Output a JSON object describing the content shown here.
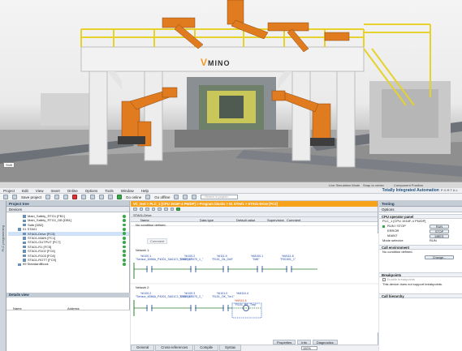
{
  "viewport": {
    "logo_text": "MINO",
    "logo_mark": "V",
    "callout": "Shift",
    "status": [
      "Live Simulation Mode",
      "Snap to vertex",
      "Component Position"
    ]
  },
  "menubar": {
    "items": [
      "Project",
      "Edit",
      "View",
      "Insert",
      "Online",
      "Options",
      "Tools",
      "Window",
      "Help"
    ],
    "brand": "Totally Integrated Automation",
    "brand_sub": "PORTAL"
  },
  "toolbar": {
    "save_label": "Save project",
    "go_online": "Go online",
    "go_offline": "Go offline",
    "search_placeholder": "<Search in project>"
  },
  "project_tree": {
    "title": "Project tree",
    "tab": "Devices",
    "side_label": "PLC programming",
    "items": [
      {
        "label": "Main_Safety_RTG1 [FB1]",
        "indent": 3,
        "ok": true
      },
      {
        "label": "Main_Safety_RTG1_DB [DB1]",
        "indent": 3,
        "ok": true
      },
      {
        "label": "Safe [DB2]",
        "indent": 3,
        "ok": true
      },
      {
        "label": "01 STA01",
        "indent": 2,
        "ok": true
      },
      {
        "label": "STA01-Drive [FC3]",
        "indent": 3,
        "ok": true,
        "selected": true
      },
      {
        "label": "STA01-MAIN [FC1]",
        "indent": 3,
        "ok": true
      },
      {
        "label": "STA01-OUTPUT [FC7]",
        "indent": 3,
        "ok": true
      },
      {
        "label": "STA01-R1 [FC5]",
        "indent": 3,
        "ok": true
      },
      {
        "label": "STA01-R102 [FC6]",
        "indent": 3,
        "ok": true
      },
      {
        "label": "STA01-R103 [FC8]",
        "indent": 3,
        "ok": true
      },
      {
        "label": "STA01-ROTT [FC9]",
        "indent": 3,
        "ok": true
      },
      {
        "label": "99 StandardBlock",
        "indent": 2,
        "ok": true
      }
    ]
  },
  "details_view": {
    "title": "Details view",
    "col_name": "Name",
    "col_address": "Address"
  },
  "editor": {
    "breadcrumb": "VC_test > PLC_1 [CPU 1516F-4 PN/DP] > Program blocks > 01 STA01 > STA01-Drive [FC3]",
    "block_title": "STA01-Drive",
    "columns": [
      "Name",
      "Data type",
      "Default value",
      "Supervision",
      "Comment"
    ],
    "rows": [
      "Input",
      "Output",
      "InOut"
    ],
    "condition": "No condition defined.",
    "comment": "Comment",
    "network1": {
      "label": "Network 1:",
      "contacts": [
        {
          "addr": "%I100.1",
          "tag": "\"Sensor_6066A_P4001_SA01C1_SNS700\""
        },
        {
          "addr": "%I100.2",
          "tag": "\"LS04_LS070_1_\""
        },
        {
          "addr": "%I111.5",
          "tag": "\"R101_Ok_Drill\""
        },
        {
          "addr": "%M100.1",
          "tag": "\"IM8\""
        },
        {
          "addr": "%M111.8",
          "tag": "\"R01501_1\""
        }
      ]
    },
    "network2": {
      "label": "Network 2:",
      "contacts": [
        {
          "addr": "%I100.2",
          "tag": "\"Sensor_6066A_P4001_SA01C1_SNS700\""
        },
        {
          "addr": "%I100.3",
          "tag": "\"LS04_LS070_2_\""
        },
        {
          "addr": "%I101.0",
          "tag": "\"R101_OK_Tm1\""
        }
      ],
      "coil": {
        "addr": "%M110.4",
        "tag": "\"R101_RE_Tmp\"",
        "highlight": "%M111.6"
      }
    },
    "zoom": "100%",
    "inspector_tabs": [
      "Properties",
      "Info",
      "Diagnostics"
    ],
    "bottom_tabs": [
      "General",
      "Cross-references",
      "Compile",
      "Syntax"
    ]
  },
  "testing": {
    "title": "Testing",
    "options": "Options",
    "cpu_panel": {
      "title": "CPU operator panel",
      "cpu": "PLC_1 [CPU 1516F-4 PN/DP]",
      "run_stop": "RUN / STOP",
      "error": "ERROR",
      "maint": "MAINT",
      "run_btn": "RUN",
      "stop_btn": "STOP",
      "mres_btn": "MRES",
      "mode_label": "Mode selector:",
      "mode_value": "RUN"
    },
    "call_env": {
      "title": "Call environment",
      "text": "No condition defined.",
      "change_btn": "Change..."
    },
    "breakpoints": {
      "title": "Breakpoints",
      "enable": "Enable breakpoints",
      "note": "This device does not support breakpoints."
    },
    "call_hierarchy": "Call hierarchy"
  }
}
